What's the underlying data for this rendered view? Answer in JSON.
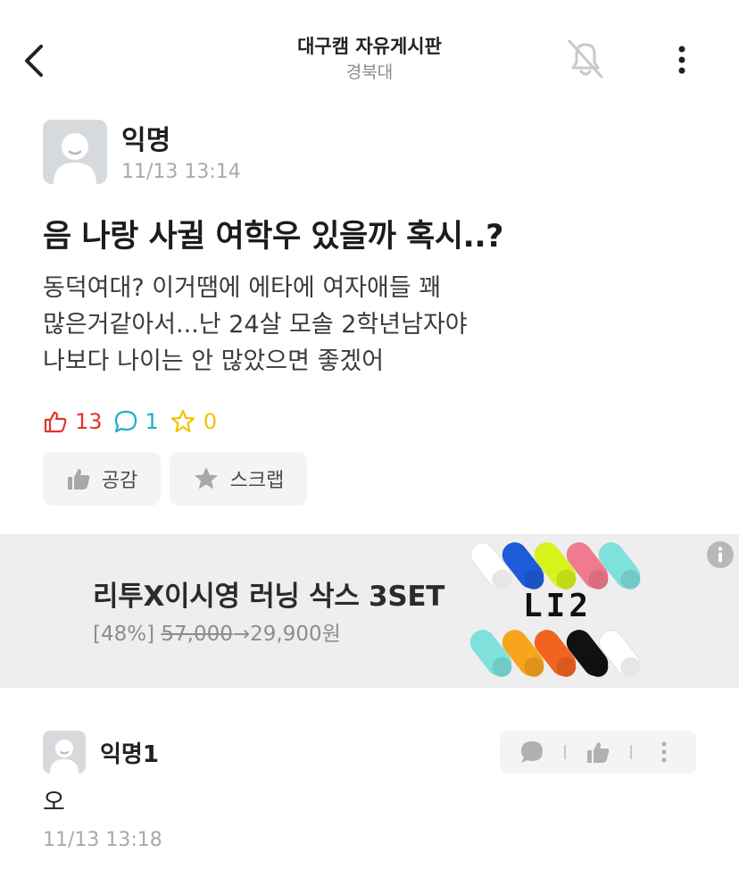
{
  "header": {
    "board_title": "대구캠 자유게시판",
    "school": "경북대",
    "icons": {
      "back": "chevron-left-icon",
      "notification": "bell-off-icon",
      "more": "more-vertical-icon"
    }
  },
  "post": {
    "author": "익명",
    "time": "11/13 13:14",
    "title": "음 나랑 사귈 여학우 있을까 혹시..?",
    "body_lines": [
      "동덕여대? 이거땜에 에타에 여자애들 꽤",
      "많은거같아서...난 24살 모솔 2학년남자야",
      "나보다 나이는 안 많았으면 좋겠어"
    ],
    "counts": {
      "likes": "13",
      "comments": "1",
      "scraps": "0"
    },
    "actions": {
      "empathy": "공감",
      "scrap": "스크랩"
    }
  },
  "ad": {
    "title": "리투X이시영 러닝 삭스 3SET",
    "discount": "[48%]",
    "original_price": "57,000",
    "sale_price": "→29,900원",
    "brand": "LI2"
  },
  "comment": {
    "author": "익명1",
    "text": "오",
    "time": "11/13 13:18"
  },
  "colors": {
    "like": "#e2352c",
    "comment": "#1bb0c4",
    "scrap": "#f2c200",
    "muted": "#a9a9a9",
    "ad_bg": "#eeeeee",
    "socks_top": [
      "#ffffff",
      "#1d5bd8",
      "#d7f21c",
      "#f27a8e",
      "#7fe0dc"
    ],
    "socks_bottom": [
      "#7fe0dc",
      "#f7a51d",
      "#f26322",
      "#111111",
      "#ffffff"
    ]
  }
}
